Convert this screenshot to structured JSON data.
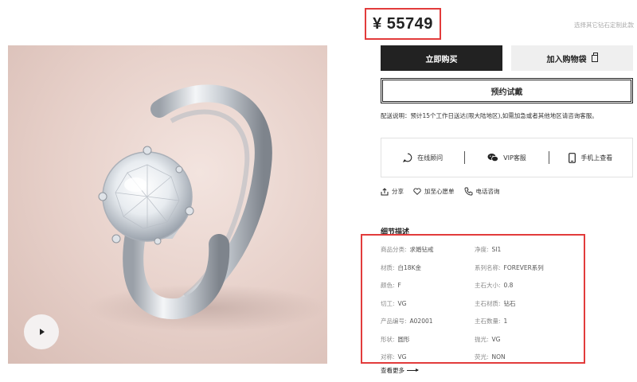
{
  "product": {
    "price": "¥ 55749",
    "customize_link": "选择其它钻石定制此款",
    "buy_label": "立即购买",
    "cart_label": "加入购物袋",
    "reserve_label": "预约试戴",
    "shipping_note": "配送说明：预计15个工作日送达(限大陆地区),如需加急或者其他地区请咨询客服。"
  },
  "services": [
    {
      "label": "在线顾问",
      "icon": "chat-bubble-icon"
    },
    {
      "label": "VIP客服",
      "icon": "wechat-icon"
    },
    {
      "label": "手机上查看",
      "icon": "mobile-phone-icon"
    }
  ],
  "actions": [
    {
      "label": "分享",
      "icon": "share-icon"
    },
    {
      "label": "加至心愿单",
      "icon": "heart-icon"
    },
    {
      "label": "电话咨询",
      "icon": "phone-icon"
    }
  ],
  "details": {
    "title": "细节描述",
    "rows": [
      {
        "key": "商品分类:",
        "value": "求婚钻戒"
      },
      {
        "key": "净度:",
        "value": "SI1"
      },
      {
        "key": "材质:",
        "value": "白18K金"
      },
      {
        "key": "系列名称:",
        "value": "FOREVER系列"
      },
      {
        "key": "颜色:",
        "value": "F"
      },
      {
        "key": "主石大小:",
        "value": "0.8"
      },
      {
        "key": "切工:",
        "value": "VG"
      },
      {
        "key": "主石材质:",
        "value": "钻石"
      },
      {
        "key": "产品编号:",
        "value": "A02001"
      },
      {
        "key": "主石数量:",
        "value": "1"
      },
      {
        "key": "形状:",
        "value": "圆形"
      },
      {
        "key": "抛光:",
        "value": "VG"
      },
      {
        "key": "对称:",
        "value": "VG"
      },
      {
        "key": "荧光:",
        "value": "NON"
      }
    ],
    "see_more": "查看更多"
  },
  "colors": {
    "accent_border": "#e23b3b",
    "primary_button": "#222222"
  }
}
